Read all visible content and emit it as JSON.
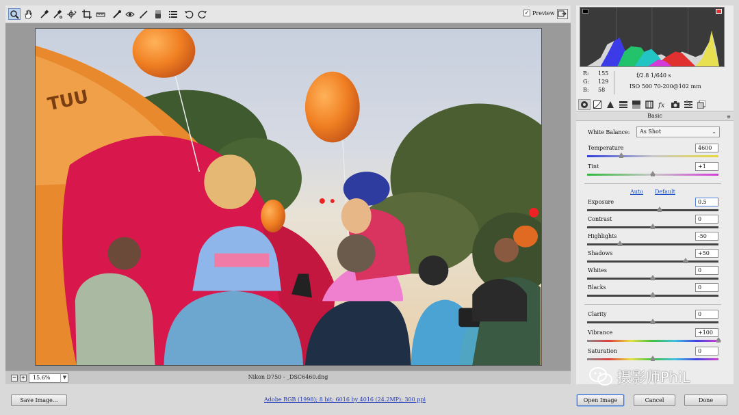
{
  "toolbar": {
    "tools": [
      "zoom-icon",
      "hand-icon",
      "white-balance-icon",
      "color-sampler-icon",
      "targeted-adjustment-icon",
      "crop-icon",
      "straighten-icon",
      "spot-removal-icon",
      "red-eye-icon",
      "adjustment-brush-icon",
      "graduated-filter-icon",
      "preferences-icon",
      "rotate-left-icon",
      "rotate-right-icon"
    ],
    "active_tool": "zoom-icon",
    "preview_label": "Preview",
    "preview_checked": true
  },
  "status": {
    "zoom_value": "15.6%",
    "image_info": "Nikon D750  -  _DSC6460.dng"
  },
  "histogram": {
    "readout": {
      "r_label": "R:",
      "r": "155",
      "g_label": "G:",
      "g": "129",
      "b_label": "B:",
      "b": "58"
    },
    "exif_line1": "f/2.8   1/640 s",
    "exif_line2": "ISO 500   70-200@102 mm"
  },
  "panel": {
    "tabs": [
      "basic-icon",
      "tone-curve-icon",
      "detail-icon",
      "hsl-icon",
      "split-toning-icon",
      "lens-corrections-icon",
      "effects-icon",
      "camera-calibration-icon",
      "presets-icon",
      "snapshots-icon"
    ],
    "title": "Basic",
    "white_balance_label": "White Balance:",
    "white_balance_value": "As Shot",
    "auto_label": "Auto",
    "default_label": "Default",
    "sliders": {
      "temperature": {
        "label": "Temperature",
        "value": "4600",
        "position": 0.26
      },
      "tint": {
        "label": "Tint",
        "value": "+1",
        "position": 0.5
      },
      "exposure": {
        "label": "Exposure",
        "value": "0.5",
        "position": 0.55
      },
      "contrast": {
        "label": "Contrast",
        "value": "0",
        "position": 0.5
      },
      "highlights": {
        "label": "Highlights",
        "value": "-50",
        "position": 0.25
      },
      "shadows": {
        "label": "Shadows",
        "value": "+50",
        "position": 0.75
      },
      "whites": {
        "label": "Whites",
        "value": "0",
        "position": 0.5
      },
      "blacks": {
        "label": "Blacks",
        "value": "0",
        "position": 0.5
      },
      "clarity": {
        "label": "Clarity",
        "value": "0",
        "position": 0.5
      },
      "vibrance": {
        "label": "Vibrance",
        "value": "+100",
        "position": 1.0
      },
      "saturation": {
        "label": "Saturation",
        "value": "0",
        "position": 0.5
      }
    }
  },
  "bottom": {
    "save_label": "Save Image...",
    "workflow_link": "Adobe RGB (1998); 8 bit; 6016 by 4016 (24.2MP); 300 ppi",
    "open_label": "Open Image",
    "cancel_label": "Cancel",
    "done_label": "Done"
  },
  "watermark": {
    "text": "摄影师PhiL"
  },
  "colors": {
    "accent": "#1b4fc4",
    "balloon": "#f07f22",
    "active_tool_bg": "#bcd3ee"
  }
}
